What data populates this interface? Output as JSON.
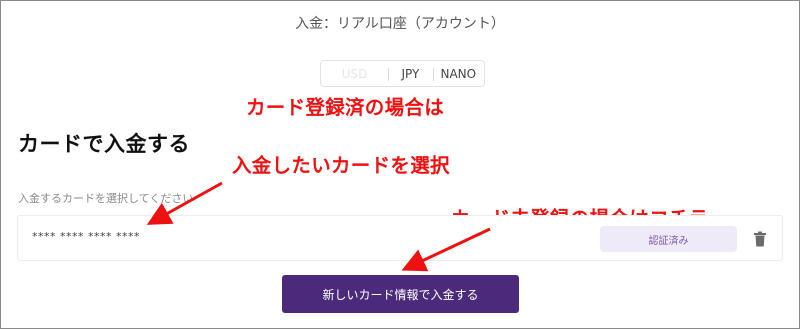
{
  "page": {
    "title": "入金：リアル口座（アカウント）"
  },
  "currency": {
    "options": [
      "USD",
      "JPY",
      "NANO"
    ]
  },
  "section": {
    "heading": "カードで入金する",
    "select_label": "入金するカードを選択してください"
  },
  "card": {
    "number": "**** **** **** ****",
    "status": "認証済み",
    "delete_icon": "trash-icon"
  },
  "button": {
    "new_card": "新しいカード情報で入金する"
  },
  "annotations": {
    "registered": "カード登録済の場合は",
    "select": "入金したいカードを選択",
    "unregistered": "カード未登録の場合はコチラ"
  },
  "colors": {
    "accent": "#4b2a7b",
    "badge_bg": "#efeaf7",
    "annotation": "#ee1111"
  }
}
